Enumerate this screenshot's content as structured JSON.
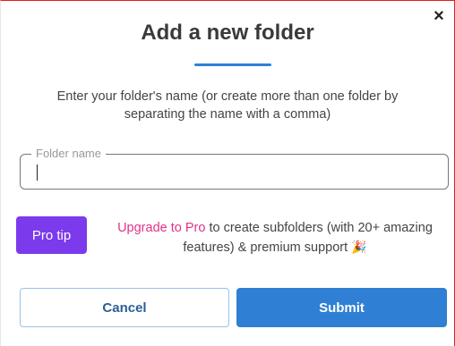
{
  "dialog": {
    "close_glyph": "×",
    "title": "Add a new folder",
    "description": "Enter your folder's name (or create more than one folder by separating the name with a comma)"
  },
  "folder_field": {
    "label": "Folder name",
    "value": ""
  },
  "pro_tip": {
    "badge": "Pro tip",
    "link_text": "Upgrade to Pro",
    "text": " to create subfolders (with 20+ amazing features) & premium support ",
    "emoji": "🎉"
  },
  "actions": {
    "cancel_label": "Cancel",
    "submit_label": "Submit"
  },
  "colors": {
    "accent": "#2f80d4",
    "pro_badge": "#7c3aed",
    "upgrade_link": "#e0338a"
  }
}
